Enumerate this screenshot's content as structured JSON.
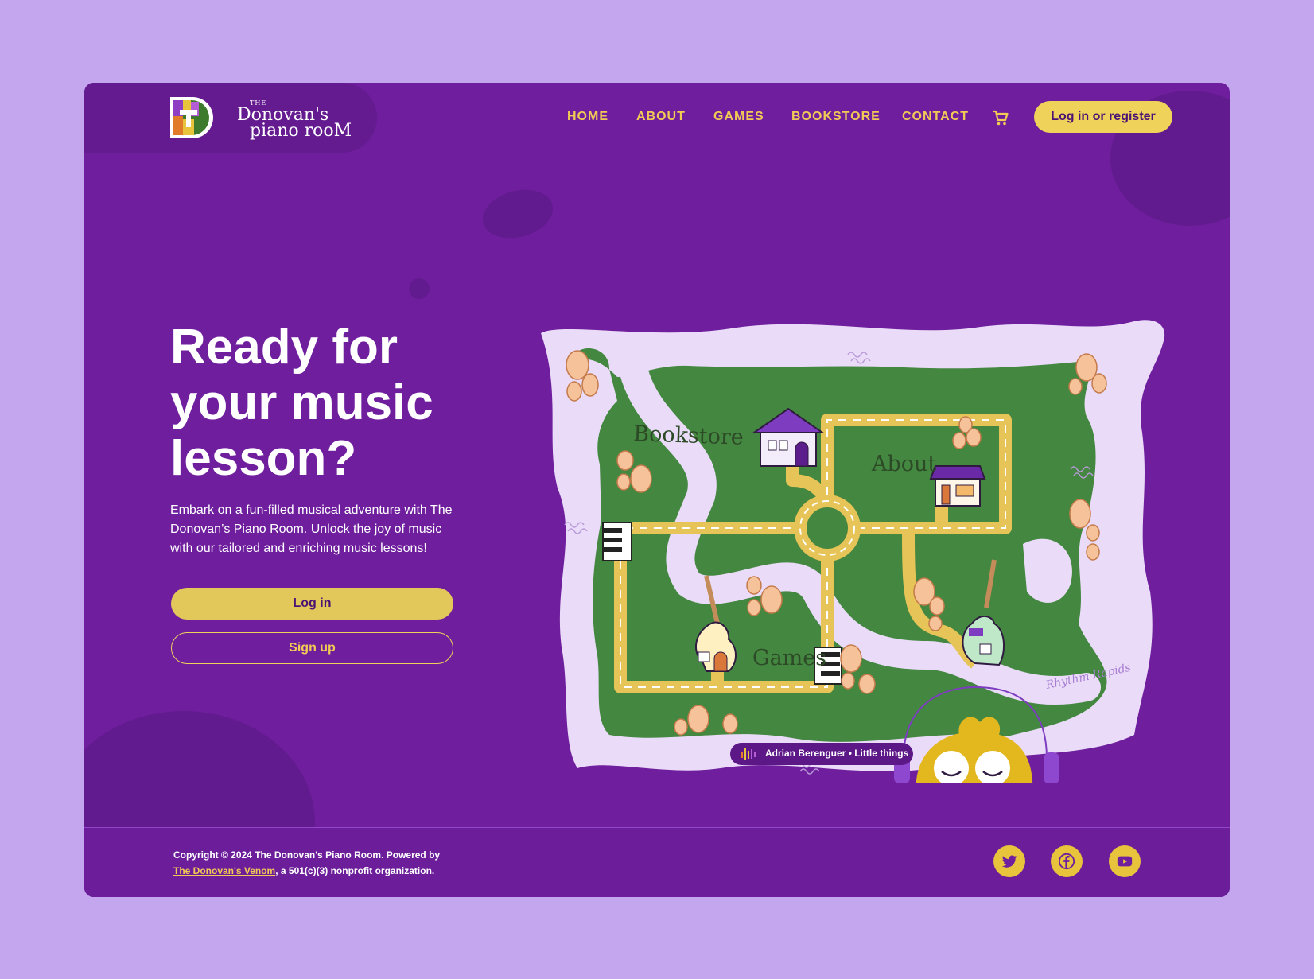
{
  "brand": {
    "logo_small": "THE",
    "logo_line1": "Donovan's",
    "logo_line2": "piano rooM"
  },
  "nav": {
    "items": [
      "HOME",
      "ABOUT",
      "GAMES",
      "BOOKSTORE",
      "CONTACT"
    ],
    "cart_icon": "cart-icon",
    "login_register": "Log in or register"
  },
  "hero": {
    "title": "Ready for your music lesson?",
    "subtitle": "Embark on a fun-filled musical adventure with The Donovan’s Piano Room. Unlock the joy of music with our tailored and enriching music lessons!",
    "login_button": "Log in",
    "signup_button": "Sign up"
  },
  "map": {
    "labels": {
      "bookstore": "Bookstore",
      "about": "About",
      "games": "Games",
      "river": "Rhythm Rapids"
    }
  },
  "music": {
    "now_playing": "Adrian Berenguer • Little things"
  },
  "footer": {
    "copyright": "Copyright © 2024 The Donovan's Piano Room. Powered by ",
    "powered_link": "The Donovan's Venom",
    "suffix": ", a 501(c)(3) nonprofit organization.",
    "social": [
      "twitter-icon",
      "facebook-icon",
      "youtube-icon"
    ]
  },
  "colors": {
    "page_bg": "#c4a6ef",
    "card_bg": "#6f1f9e",
    "accent_yellow": "#eed25a",
    "map_green": "#448741",
    "river": "#eadcf8"
  }
}
